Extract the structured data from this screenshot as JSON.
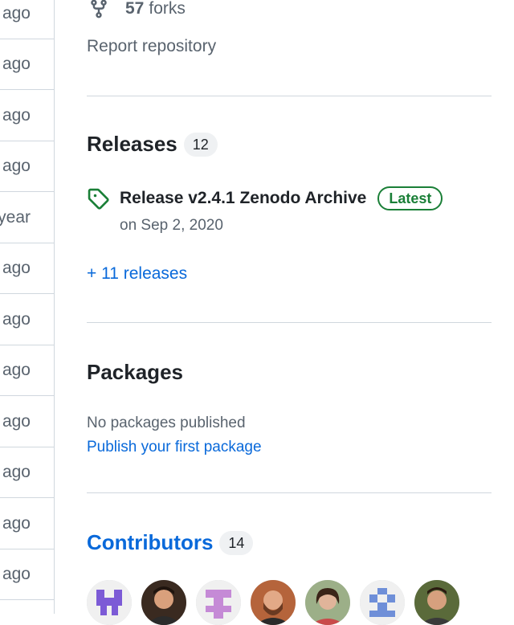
{
  "left_column": {
    "items": [
      "ago",
      "ago",
      "ago",
      "ago",
      "year",
      "ago",
      "ago",
      "ago",
      "ago",
      "ago",
      "ago",
      "ago"
    ]
  },
  "forks": {
    "count": "57",
    "label": "forks"
  },
  "report_link": "Report repository",
  "releases": {
    "title": "Releases",
    "count": "12",
    "latest": {
      "name": "Release v2.4.1 Zenodo Archive",
      "badge": "Latest",
      "date": "on Sep 2, 2020"
    },
    "more_link": "+ 11 releases"
  },
  "packages": {
    "title": "Packages",
    "empty_text": "No packages published",
    "publish_link": "Publish your first package"
  },
  "contributors": {
    "title": "Contributors",
    "count": "14",
    "avatars": [
      {
        "kind": "identicon",
        "color": "#7c5bd6"
      },
      {
        "kind": "photo",
        "color": "#5a3b2a"
      },
      {
        "kind": "identicon",
        "color": "#c58ad6"
      },
      {
        "kind": "photo",
        "color": "#8a4a2a"
      },
      {
        "kind": "photo",
        "color": "#6b4a3a"
      },
      {
        "kind": "identicon",
        "color": "#6f8fd8"
      },
      {
        "kind": "photo",
        "color": "#4a3a2a"
      }
    ]
  },
  "colors": {
    "link": "#0969da",
    "muted": "#59636e",
    "latest": "#1a7f37",
    "border": "#d0d7de"
  },
  "icons": {
    "fork": "repo-forked-icon",
    "tag": "tag-icon"
  }
}
